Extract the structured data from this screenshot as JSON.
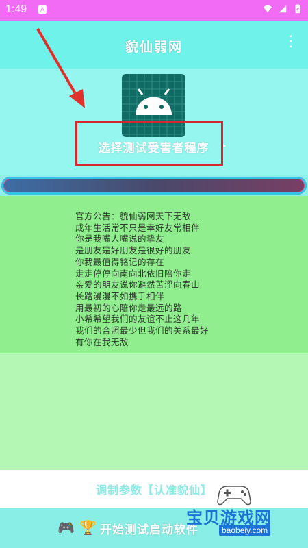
{
  "status_bar": {
    "time": "1:49",
    "notification_icon": "app-notification-icon",
    "wifi_icon": "wifi-icon",
    "signal_icon": "signal-icon",
    "battery_icon": "battery-charging-icon"
  },
  "app_bar": {
    "title": "貌仙弱网",
    "menu_icon": "overflow-menu-icon"
  },
  "program_selector": {
    "label": "选择测试受害者程序",
    "app_icon": "android-app-icon",
    "arrow_icon": "dropdown-arrow-icon"
  },
  "notice": {
    "text": "官方公告：貌仙弱网天下无敌\n成年生活常不只是幸好友常相伴\n你是我嘴人嘴说的挚友\n是朋友是好朋友是很好的朋友\n你我最值得铭记的存在\n走走停停向南向北依旧陪你走\n亲爱的朋友说你避然苦涩向春山\n长路漫漫不如携手相伴\n用最初的心陪你走最远的路\n小希希望我们的友谊不止这几年\n我们的合照最少但我们的关系最好\n有你在我无敌"
  },
  "params_button": {
    "label": "调制参数【认准貌仙】"
  },
  "start_button": {
    "label": "开始测试启动软件",
    "icons": [
      "gamepad-icon",
      "trophy-icon"
    ]
  },
  "watermark": {
    "text": "宝贝游戏网",
    "url": "baobeiy.com"
  },
  "colors": {
    "status_bar": "#f26bf5",
    "app_bar": "#6ef2ea",
    "hero": "#94f6ef",
    "notice_bg": "#90ee8e",
    "lower_bg": "#b4f6b4",
    "start_bg": "#89efe6",
    "highlight": "#d9252c"
  }
}
